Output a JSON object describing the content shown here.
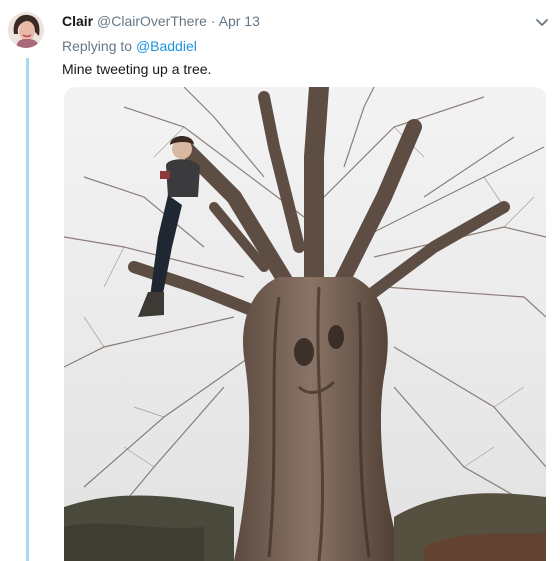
{
  "tweet": {
    "author_name": "Clair",
    "handle": "@ClairOverThere",
    "separator": "·",
    "date": "Apr 13",
    "replying_prefix": "Replying to",
    "replying_mention": "@Baddiel",
    "text": "Mine tweeting up a tree."
  },
  "icons": {
    "more": "chevron-down-icon",
    "avatar": "profile-photo",
    "photo": "tree-with-person-photo"
  },
  "colors": {
    "link": "#1b95e0",
    "thread_line": "#a8d9f3",
    "secondary_text": "#657786",
    "primary_text": "#14171a"
  }
}
